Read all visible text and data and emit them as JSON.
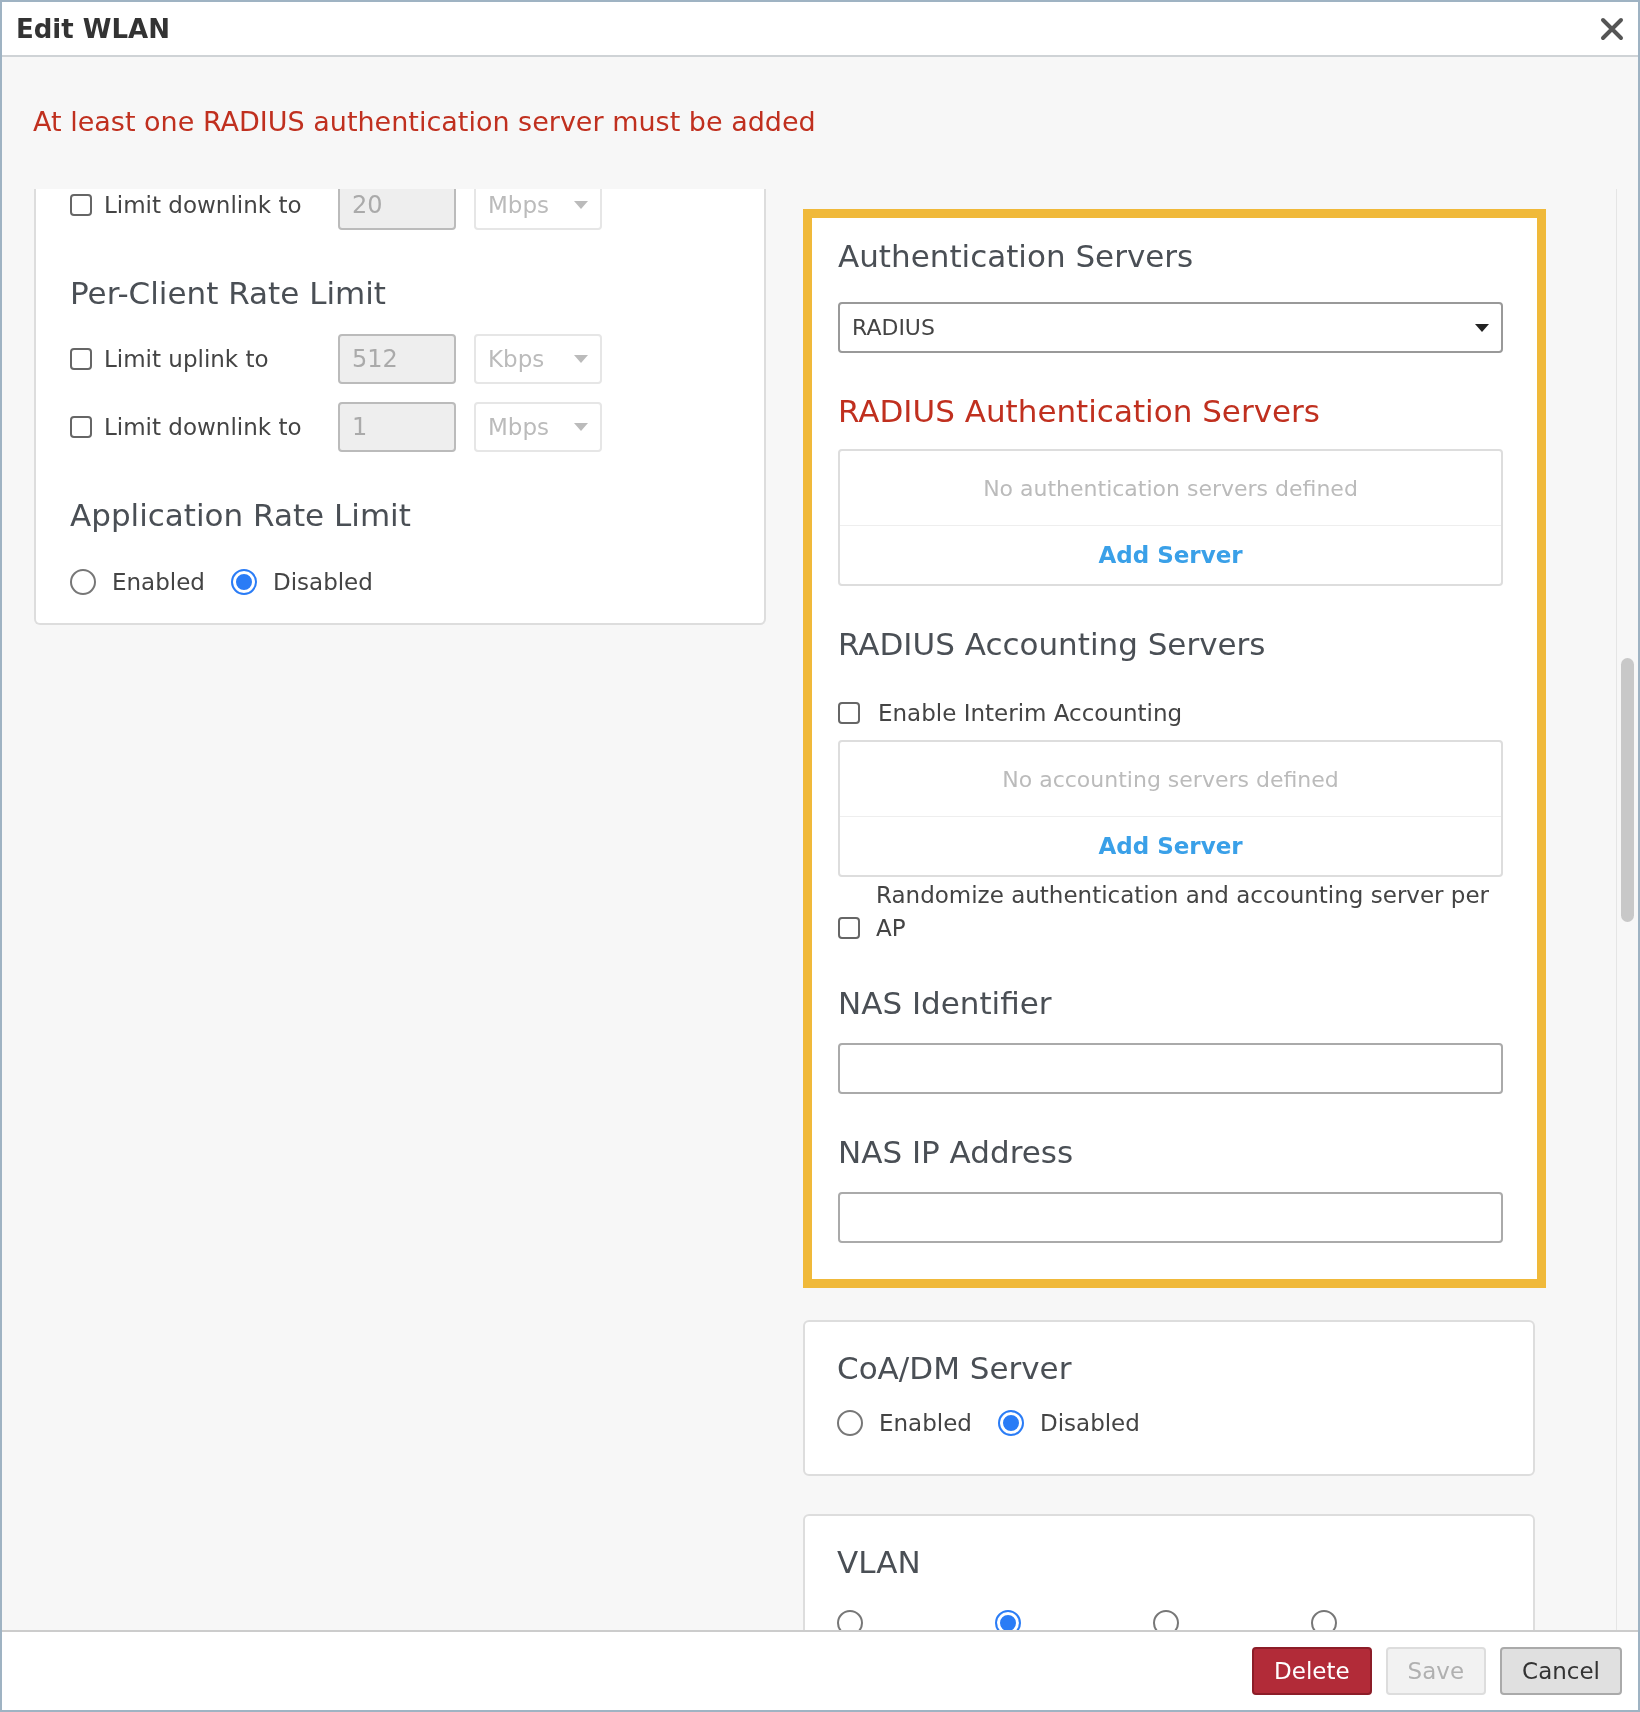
{
  "window": {
    "title": "Edit WLAN"
  },
  "error": "At least one RADIUS authentication server must be added",
  "rate_limit": {
    "rows": [
      {
        "label": "Limit downlink to",
        "checked": false,
        "disabled": true,
        "value": "20",
        "unit": "Mbps"
      }
    ]
  },
  "per_client_rate_limit": {
    "title": "Per-Client Rate Limit",
    "rows": [
      {
        "label": "Limit uplink to",
        "checked": false,
        "disabled": true,
        "value": "512",
        "unit": "Kbps"
      },
      {
        "label": "Limit downlink to",
        "checked": false,
        "disabled": true,
        "value": "1",
        "unit": "Mbps"
      }
    ]
  },
  "application_rate_limit": {
    "title": "Application Rate Limit",
    "options": [
      {
        "label": "Enabled",
        "selected": false
      },
      {
        "label": "Disabled",
        "selected": true
      }
    ]
  },
  "authentication_servers": {
    "title": "Authentication Servers",
    "type": "RADIUS",
    "radius_auth": {
      "title": "RADIUS Authentication Servers",
      "invalid": true,
      "empty_text": "No authentication servers defined",
      "add_label": "Add Server"
    },
    "radius_accounting": {
      "title": "RADIUS Accounting Servers",
      "interim": {
        "label": "Enable Interim Accounting",
        "checked": false
      },
      "empty_text": "No accounting servers defined",
      "add_label": "Add Server"
    },
    "randomize": {
      "label": "Randomize authentication and accounting server per AP",
      "checked": false
    },
    "nas_identifier": {
      "label": "NAS Identifier"
    },
    "nas_ip_address": {
      "label": "NAS IP Address"
    }
  },
  "coa_dm_server": {
    "title": "CoA/DM Server",
    "options": [
      {
        "label": "Enabled",
        "selected": false
      },
      {
        "label": "Disabled",
        "selected": true
      }
    ]
  },
  "vlan": {
    "title": "VLAN",
    "options": [
      {
        "selected": false
      },
      {
        "selected": true
      },
      {
        "selected": false
      },
      {
        "selected": false
      }
    ]
  },
  "buttons": [
    {
      "label": "Delete",
      "kind": "danger",
      "disabled": false
    },
    {
      "label": "Save",
      "kind": "primary",
      "disabled": true
    },
    {
      "label": "Cancel",
      "kind": "default",
      "disabled": false
    }
  ]
}
